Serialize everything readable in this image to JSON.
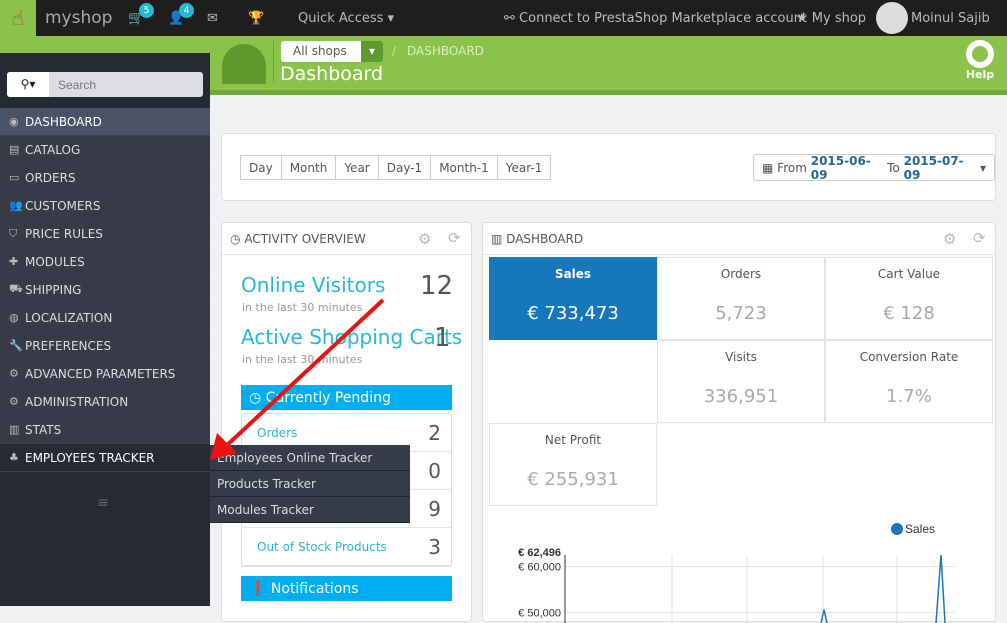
{
  "topbar": {
    "shop": "myshop",
    "cart_badge": "5",
    "customers_badge": "4",
    "quick_access": "Quick Access",
    "marketplace": "Connect to PrestaShop Marketplace account",
    "my_shop": "My shop",
    "user": "Moinul Sajib"
  },
  "header": {
    "shop_select": "All shops",
    "breadcrumb": "DASHBOARD",
    "title": "Dashboard",
    "help": "Help"
  },
  "search": {
    "placeholder": "Search"
  },
  "sidebar": {
    "items": [
      {
        "label": "DASHBOARD",
        "icon": "dashboard-icon"
      },
      {
        "label": "CATALOG",
        "icon": "book-icon"
      },
      {
        "label": "ORDERS",
        "icon": "credit-card-icon"
      },
      {
        "label": "CUSTOMERS",
        "icon": "users-icon"
      },
      {
        "label": "PRICE RULES",
        "icon": "tag-icon"
      },
      {
        "label": "MODULES",
        "icon": "puzzle-icon"
      },
      {
        "label": "SHIPPING",
        "icon": "truck-icon"
      },
      {
        "label": "LOCALIZATION",
        "icon": "globe-icon"
      },
      {
        "label": "PREFERENCES",
        "icon": "wrench-icon"
      },
      {
        "label": "ADVANCED PARAMETERS",
        "icon": "cogs-icon"
      },
      {
        "label": "ADMINISTRATION",
        "icon": "cog-icon"
      },
      {
        "label": "STATS",
        "icon": "bar-chart-icon"
      },
      {
        "label": "EMPLOYEES TRACKER",
        "icon": "employees-icon"
      }
    ],
    "submenu": [
      "Employees Online Tracker",
      "Products Tracker",
      "Modules Tracker"
    ]
  },
  "date": {
    "buttons": [
      "Day",
      "Month",
      "Year",
      "Day-1",
      "Month-1",
      "Year-1"
    ],
    "from_label": "From",
    "from": "2015-06-09",
    "to_label": "To",
    "to": "2015-07-09"
  },
  "activity": {
    "title": "ACTIVITY OVERVIEW",
    "online_visitors": "Online Visitors",
    "online_sub": "in the last 30 minutes",
    "online_value": "12",
    "carts": "Active Shopping Carts",
    "carts_sub": "in the last 30 minutes",
    "carts_value": "1",
    "pending_title": "Currently Pending",
    "pending": [
      {
        "label": "Orders",
        "value": "2"
      },
      {
        "label": "",
        "value": "0"
      },
      {
        "label": "",
        "value": "9"
      },
      {
        "label": "Out of Stock Products",
        "value": "3"
      }
    ],
    "notifications": "Notifications"
  },
  "dashboard": {
    "title": "DASHBOARD",
    "kpis": [
      {
        "label": "Sales",
        "value": "€ 733,473"
      },
      {
        "label": "Orders",
        "value": "5,723"
      },
      {
        "label": "Cart Value",
        "value": "€ 128"
      },
      {
        "label": "Visits",
        "value": "336,951"
      },
      {
        "label": "Conversion Rate",
        "value": "1.7%"
      },
      {
        "label": "Net Profit",
        "value": "€ 255,931"
      }
    ]
  },
  "chart_data": {
    "type": "line",
    "series": [
      {
        "name": "Sales",
        "color": "#1f77b4"
      }
    ],
    "yticks": [
      "€ 62,496",
      "€ 60,000",
      "€ 50,000"
    ],
    "ymax": 62496,
    "legend": "top-right"
  },
  "colors": {
    "green": "#8bc34a",
    "blue": "#00aff0",
    "sales": "#1777bd"
  }
}
